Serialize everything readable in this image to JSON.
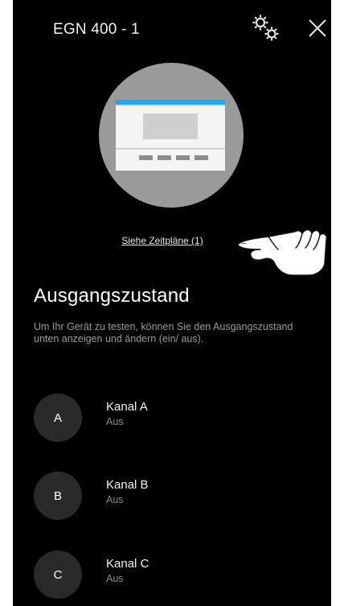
{
  "header": {
    "title": "EGN 400 - 1",
    "settings_icon": "gears-icon",
    "close_icon": "close-icon"
  },
  "device": {
    "illustration": "timer-device-illustration",
    "schedules_link": "Siehe Zeitpläne (1)",
    "pointer_icon": "pointing-hand-icon"
  },
  "output": {
    "title": "Ausgangszustand",
    "description": "Um Ihr Gerät zu testen, können Sie den Ausgangszustand unten anzeigen und ändern (ein/ aus).",
    "channels": [
      {
        "letter": "A",
        "name": "Kanal A",
        "state": "Aus"
      },
      {
        "letter": "B",
        "name": "Kanal B",
        "state": "Aus"
      },
      {
        "letter": "C",
        "name": "Kanal C",
        "state": "Aus"
      }
    ]
  },
  "colors": {
    "background": "#000000",
    "accent": "#2aa3e0",
    "circle": "#9a9a9a",
    "avatar": "#2a2a2a"
  }
}
